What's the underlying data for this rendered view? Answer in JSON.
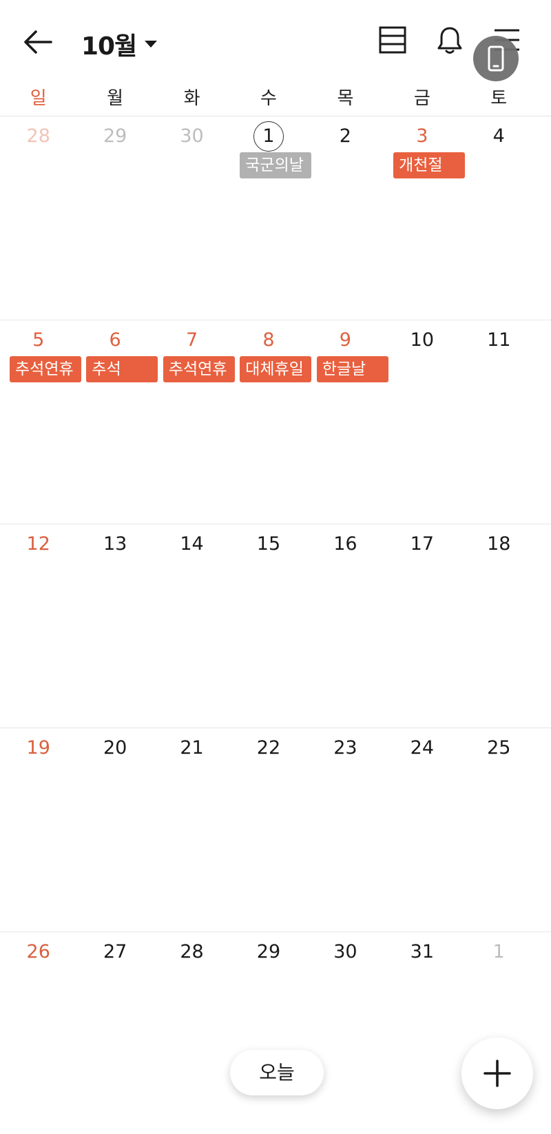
{
  "header": {
    "month_label": "10월",
    "icons": [
      "arrow-left-icon",
      "list-view-icon",
      "bell-icon",
      "menu-icon",
      "phone-icon"
    ]
  },
  "weekdays": [
    "일",
    "월",
    "화",
    "수",
    "목",
    "금",
    "토"
  ],
  "weeks": [
    [
      {
        "num": "28",
        "other": true,
        "sun": true
      },
      {
        "num": "29",
        "other": true
      },
      {
        "num": "30",
        "other": true
      },
      {
        "num": "1",
        "today": true,
        "event": {
          "title": "국군의날",
          "style": "grey"
        }
      },
      {
        "num": "2"
      },
      {
        "num": "3",
        "holiday": true,
        "event": {
          "title": "개천절",
          "style": "red"
        }
      },
      {
        "num": "4"
      }
    ],
    [
      {
        "num": "5",
        "sun": true,
        "holiday": true,
        "event": {
          "title": "추석연휴",
          "style": "red"
        }
      },
      {
        "num": "6",
        "holiday": true,
        "event": {
          "title": "추석",
          "style": "red"
        }
      },
      {
        "num": "7",
        "holiday": true,
        "event": {
          "title": "추석연휴",
          "style": "red"
        }
      },
      {
        "num": "8",
        "holiday": true,
        "event": {
          "title": "대체휴일",
          "style": "red"
        }
      },
      {
        "num": "9",
        "holiday": true,
        "event": {
          "title": "한글날",
          "style": "red"
        }
      },
      {
        "num": "10"
      },
      {
        "num": "11"
      }
    ],
    [
      {
        "num": "12",
        "sun": true
      },
      {
        "num": "13"
      },
      {
        "num": "14"
      },
      {
        "num": "15"
      },
      {
        "num": "16"
      },
      {
        "num": "17"
      },
      {
        "num": "18"
      }
    ],
    [
      {
        "num": "19",
        "sun": true
      },
      {
        "num": "20"
      },
      {
        "num": "21"
      },
      {
        "num": "22"
      },
      {
        "num": "23"
      },
      {
        "num": "24"
      },
      {
        "num": "25"
      }
    ],
    [
      {
        "num": "26",
        "sun": true
      },
      {
        "num": "27"
      },
      {
        "num": "28"
      },
      {
        "num": "29"
      },
      {
        "num": "30"
      },
      {
        "num": "31"
      },
      {
        "num": "1",
        "other": true
      }
    ]
  ],
  "footer": {
    "today_label": "오늘",
    "add_icon": "plus-icon"
  },
  "colors": {
    "accent": "#e8603f",
    "event_grey": "#b1b1b1",
    "sunday_text": "#d9603f",
    "muted_text": "#bdbdbd"
  }
}
